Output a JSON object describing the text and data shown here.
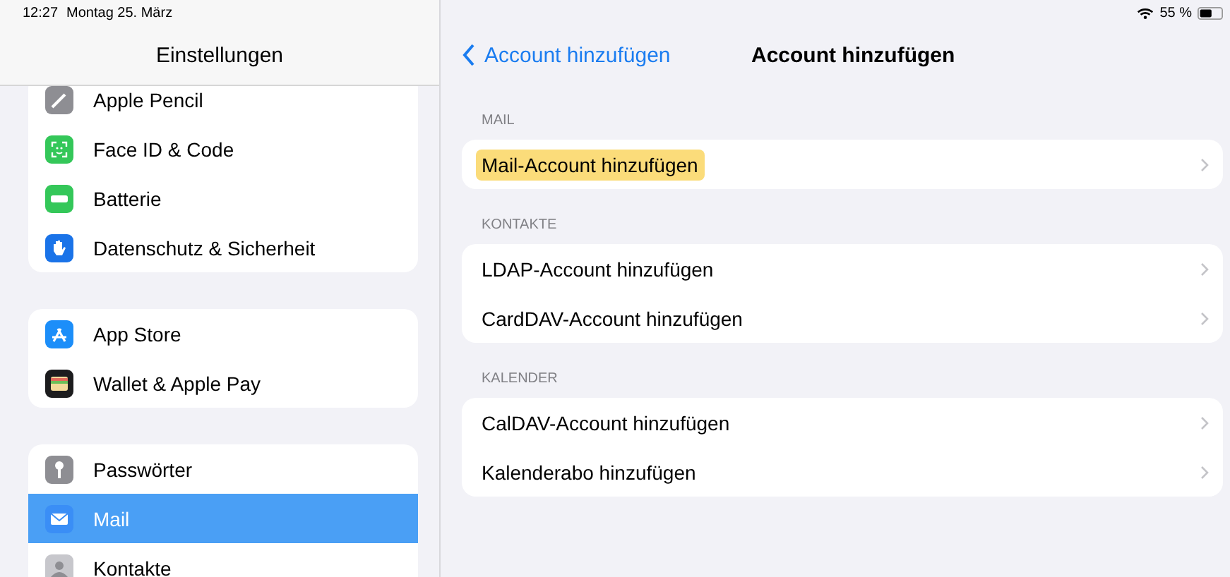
{
  "status_bar": {
    "time": "12:27",
    "date": "Montag 25. März",
    "battery": "55 %"
  },
  "sidebar": {
    "title": "Einstellungen",
    "groups": [
      [
        {
          "label": "Apple Pencil",
          "kind": "pencil",
          "selected": false
        },
        {
          "label": "Face ID & Code",
          "kind": "faceid",
          "selected": false
        },
        {
          "label": "Batterie",
          "kind": "battery",
          "selected": false
        },
        {
          "label": "Datenschutz & Sicherheit",
          "kind": "hand",
          "selected": false
        }
      ],
      [
        {
          "label": "App Store",
          "kind": "appstore",
          "selected": false
        },
        {
          "label": "Wallet & Apple Pay",
          "kind": "wallet",
          "selected": false
        }
      ],
      [
        {
          "label": "Passwörter",
          "kind": "key",
          "selected": false
        },
        {
          "label": "Mail",
          "kind": "mail",
          "selected": true
        },
        {
          "label": "Kontakte",
          "kind": "contacts",
          "selected": false
        }
      ]
    ]
  },
  "detail": {
    "back": "Account hinzufügen",
    "title": "Account hinzufügen",
    "sections": [
      {
        "header": "MAIL",
        "rows": [
          {
            "label": "Mail-Account hinzufügen",
            "highlighted": true
          }
        ]
      },
      {
        "header": "KONTAKTE",
        "rows": [
          {
            "label": "LDAP-Account hinzufügen",
            "highlighted": false
          },
          {
            "label": "CardDAV-Account hinzufügen",
            "highlighted": false
          }
        ]
      },
      {
        "header": "KALENDER",
        "rows": [
          {
            "label": "CalDAV-Account hinzufügen",
            "highlighted": false
          },
          {
            "label": "Kalenderabo hinzufügen",
            "highlighted": false
          }
        ]
      }
    ]
  }
}
